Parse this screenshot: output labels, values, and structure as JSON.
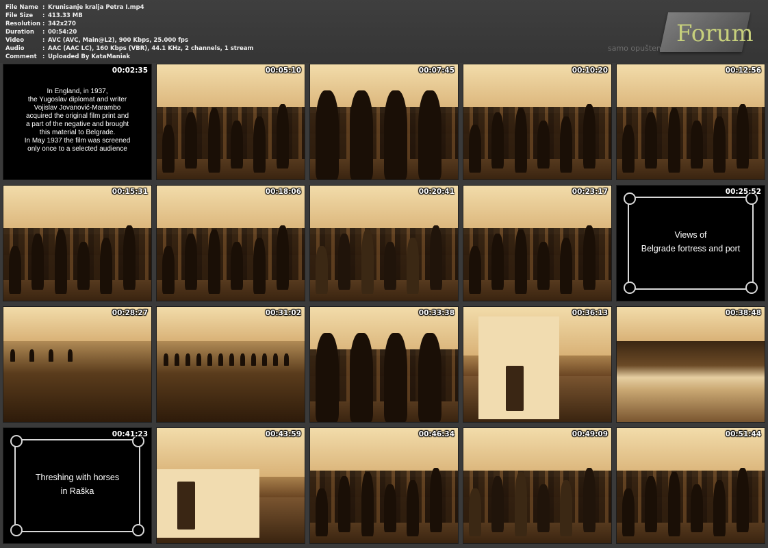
{
  "file_info": {
    "rows": [
      {
        "key": "File Name",
        "value": "Krunisanje kralja Petra I.mp4"
      },
      {
        "key": "File Size",
        "value": "413.33 MB"
      },
      {
        "key": "Resolution",
        "value": "342x270"
      },
      {
        "key": "Duration",
        "value": "00:54:20"
      },
      {
        "key": "Video",
        "value": "AVC (AVC, Main@L2), 900 Kbps, 25.000 fps"
      },
      {
        "key": "Audio",
        "value": "AAC (AAC LC), 160 Kbps (VBR), 44.1 KHz, 2 channels, 1 stream"
      },
      {
        "key": "Comment",
        "value": "Uploaded By KataManiak"
      }
    ],
    "separator": ":"
  },
  "logo": {
    "text": "Forum",
    "subtext": "samo opušteno"
  },
  "thumbnails": [
    {
      "time": "00:02:35",
      "caption": "In England, in 1937,\nthe Yugoslav diplomat and writer\nVojislav Jovanović-Marambo\nacquired the original film print and\na part of the negative and brought\nthis material to Belgrade.\nIn May 1937 the film was screened\nonly once to a selected audience"
    },
    {
      "time": "00:05:10"
    },
    {
      "time": "00:07:45"
    },
    {
      "time": "00:10:20"
    },
    {
      "time": "00:12:56"
    },
    {
      "time": "00:15:31"
    },
    {
      "time": "00:18:06"
    },
    {
      "time": "00:20:41"
    },
    {
      "time": "00:23:17"
    },
    {
      "time": "00:25:52",
      "caption": "Views of\nBelgrade fortress and port"
    },
    {
      "time": "00:28:27"
    },
    {
      "time": "00:31:02"
    },
    {
      "time": "00:33:38"
    },
    {
      "time": "00:36:13"
    },
    {
      "time": "00:38:48"
    },
    {
      "time": "00:41:23",
      "caption": "Threshing with horses\nin Raška"
    },
    {
      "time": "00:43:59"
    },
    {
      "time": "00:46:34"
    },
    {
      "time": "00:49:09"
    },
    {
      "time": "00:51:44"
    }
  ]
}
